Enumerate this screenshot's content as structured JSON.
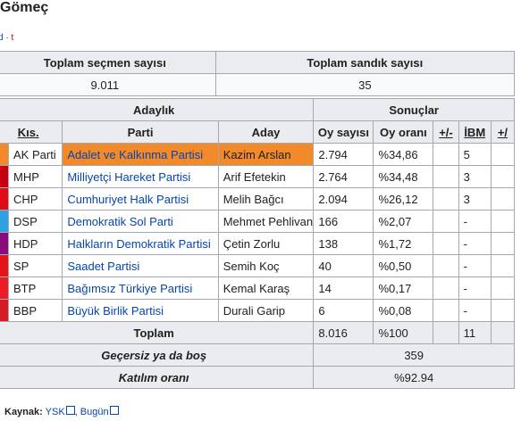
{
  "title": "Gömeç",
  "navbar": {
    "v": "d",
    "sep": "·",
    "t": "t"
  },
  "summary": {
    "voters_label": "Toplam seçmen sayısı",
    "boxes_label": "Toplam sandık sayısı",
    "voters_value": "9.011",
    "boxes_value": "35"
  },
  "results": {
    "group_candidacy": "Adaylık",
    "group_results": "Sonuçlar",
    "headers": {
      "kis": "Kıs.",
      "parti": "Parti",
      "aday": "Aday",
      "oy_sayisi": "Oy sayısı",
      "oy_orani": "Oy oranı",
      "plusminus": "+/-",
      "ibm": "İBM",
      "plusminus2": "+/"
    },
    "rows": [
      {
        "kis": "AK Parti",
        "parti": "Adalet ve Kalkınma Partisi",
        "aday": "Kazim Arslan",
        "oy": "2.794",
        "oran": "%34,86",
        "pm": "",
        "ibm": "5",
        "color": "#f28a29",
        "highlight": true
      },
      {
        "kis": "MHP",
        "parti": "Milliyetçi Hareket Partisi",
        "aday": "Arif Efetekin",
        "oy": "2.764",
        "oran": "%34,48",
        "pm": "",
        "ibm": "3",
        "color": "#c60010",
        "highlight": false
      },
      {
        "kis": "CHP",
        "parti": "Cumhuriyet Halk Partisi",
        "aday": "Melih Bağcı",
        "oy": "2.094",
        "oran": "%26,12",
        "pm": "",
        "ibm": "3",
        "color": "#e30a17",
        "highlight": false
      },
      {
        "kis": "DSP",
        "parti": "Demokratik Sol Parti",
        "aday": "Mehmet Pehlivan",
        "oy": "166",
        "oran": "%2,07",
        "pm": "",
        "ibm": "-",
        "color": "#2fa1e0",
        "highlight": false
      },
      {
        "kis": "HDP",
        "parti": "Halkların Demokratik Partisi",
        "aday": "Çetin Zorlu",
        "oy": "138",
        "oran": "%1,72",
        "pm": "",
        "ibm": "-",
        "color": "#8a0b7e",
        "highlight": false
      },
      {
        "kis": "SP",
        "parti": "Saadet Partisi",
        "aday": "Semih Koç",
        "oy": "40",
        "oran": "%0,50",
        "pm": "",
        "ibm": "-",
        "color": "#e1141c",
        "highlight": false
      },
      {
        "kis": "BTP",
        "parti": "Bağımsız Türkiye Partisi",
        "aday": "Kemal Karaş",
        "oy": "14",
        "oran": "%0,17",
        "pm": "",
        "ibm": "-",
        "color": "#ec1c24",
        "highlight": false
      },
      {
        "kis": "BBP",
        "parti": "Büyük Birlik Partisi",
        "aday": "Durali Garip",
        "oy": "6",
        "oran": "%0,08",
        "pm": "",
        "ibm": "-",
        "color": "#d51b23",
        "highlight": false
      }
    ],
    "total_label": "Toplam",
    "total_votes": "8.016",
    "total_pct": "%100",
    "total_ibm": "11",
    "invalid_label": "Geçersiz ya da boş",
    "invalid_value": "359",
    "turnout_label": "Katılım oranı",
    "turnout_value": "%92.94"
  },
  "source": {
    "label": "Kaynak:",
    "link1": "YSK",
    "sep": ",",
    "link2": "Bugün"
  },
  "colors": {
    "header_bg": "#eaecf0",
    "border": "#a2a9b1",
    "link": "#0645ad",
    "highlight": "#f28a29"
  }
}
